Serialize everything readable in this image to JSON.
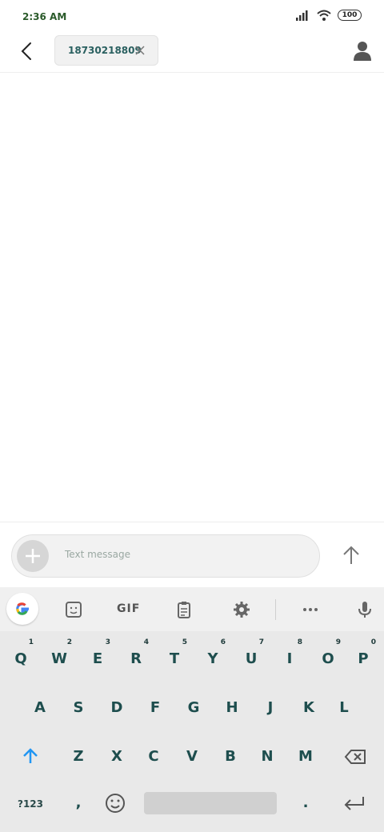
{
  "status": {
    "time": "2:36 AM",
    "battery": "100"
  },
  "header": {
    "recipient": "18730218809"
  },
  "composer": {
    "placeholder": "Text message"
  },
  "keyboard": {
    "toolbar": {
      "gif_label": "GIF"
    },
    "row1": [
      {
        "key": "Q",
        "hint": "1"
      },
      {
        "key": "W",
        "hint": "2"
      },
      {
        "key": "E",
        "hint": "3"
      },
      {
        "key": "R",
        "hint": "4"
      },
      {
        "key": "T",
        "hint": "5"
      },
      {
        "key": "Y",
        "hint": "6"
      },
      {
        "key": "U",
        "hint": "7"
      },
      {
        "key": "I",
        "hint": "8"
      },
      {
        "key": "O",
        "hint": "9"
      },
      {
        "key": "P",
        "hint": "0"
      }
    ],
    "row2": [
      "A",
      "S",
      "D",
      "F",
      "G",
      "H",
      "J",
      "K",
      "L"
    ],
    "row3": [
      "Z",
      "X",
      "C",
      "V",
      "B",
      "N",
      "M"
    ],
    "bottom": {
      "symbols": "?123",
      "comma": ",",
      "period": "."
    }
  }
}
